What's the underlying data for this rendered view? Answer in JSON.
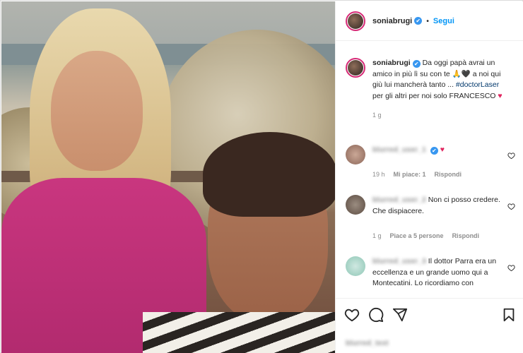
{
  "post": {
    "username": "soniabrugi",
    "verified_glyph": "✔",
    "separator": "•",
    "follow_label": "Segui"
  },
  "caption": {
    "username": "soniabrugi",
    "text_1": "Da oggi papà avrai un amico in più lì su con te",
    "text_2": "a noi qui giù lui mancherà tanto ...",
    "hashtag": "#doctorLaser",
    "text_3": "per gli altri per noi solo FRANCESCO",
    "pray_emoji": "🙏",
    "black_heart": "🖤",
    "red_heart": "♥",
    "time": "1 g"
  },
  "comments": [
    {
      "username": "blurred_user_1",
      "text": "",
      "red_heart": "♥",
      "time": "19 h",
      "likes": "Mi piace: 1",
      "reply": "Rispondi"
    },
    {
      "username": "blurred_user_2",
      "text": "Non ci posso credere. Che dispiacere.",
      "time": "1 g",
      "likes": "Piace a 5 persone",
      "reply": "Rispondi"
    },
    {
      "username": "blurred_user_3",
      "text": "Il dottor Parra era un eccellenza e un grande uomo qui a Montecatini. Lo ricordiamo con",
      "time": "",
      "likes": "",
      "reply": ""
    }
  ],
  "actions": {
    "like_icon": "heart-outline-icon",
    "comment_icon": "comment-icon",
    "share_icon": "share-icon",
    "save_icon": "bookmark-icon"
  },
  "add_comment": {
    "placeholder": "blurred_text"
  },
  "colors": {
    "link_blue": "#0095f6",
    "verified_blue": "#3897f0",
    "heart_red": "#e0245e",
    "story_ring": "#d62976"
  }
}
